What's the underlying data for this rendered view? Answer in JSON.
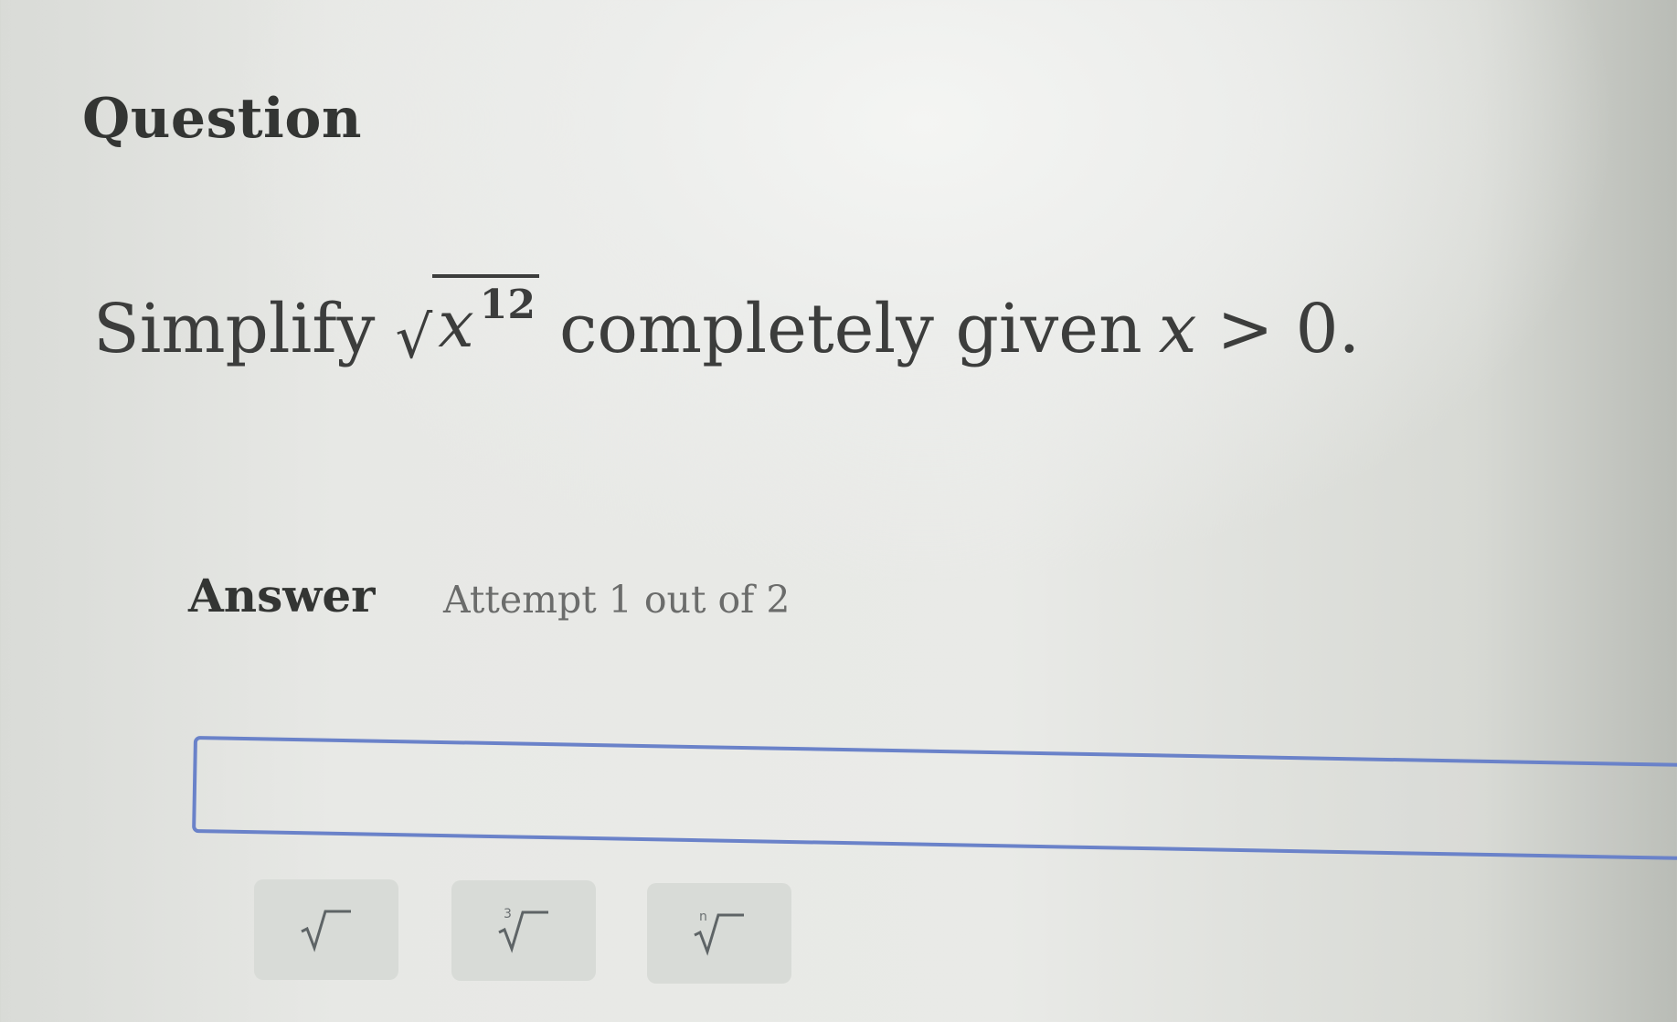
{
  "question": {
    "heading": "Question",
    "prompt_prefix": "Simplify",
    "radicand_base": "x",
    "radicand_exponent": "12",
    "prompt_middle": "completely given",
    "condition_var": "x",
    "condition_op": ">",
    "condition_value": "0."
  },
  "answer": {
    "heading": "Answer",
    "attempt_text": "Attempt 1 out of 2",
    "input_value": ""
  },
  "toolbar": {
    "buttons": [
      {
        "icon": "square-root-icon",
        "index": ""
      },
      {
        "icon": "cube-root-icon",
        "index": "3"
      },
      {
        "icon": "nth-root-icon",
        "index": "n"
      }
    ]
  },
  "colors": {
    "input_border": "#6a82c9",
    "button_bg": "#d8dbd7"
  }
}
